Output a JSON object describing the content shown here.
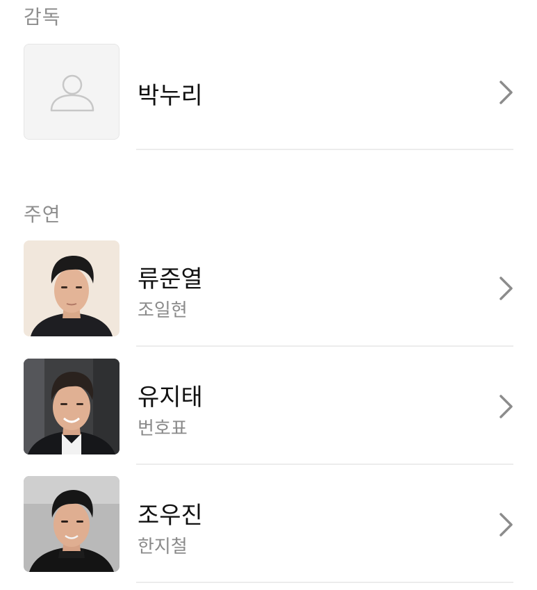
{
  "sections": {
    "director": {
      "label": "감독",
      "people": [
        {
          "name": "박누리",
          "role": "",
          "photo": "person-placeholder-icon"
        }
      ]
    },
    "cast": {
      "label": "주연",
      "people": [
        {
          "name": "류준열",
          "role": "조일현",
          "photo": "actor-photo"
        },
        {
          "name": "유지태",
          "role": "번호표",
          "photo": "actor-photo"
        },
        {
          "name": "조우진",
          "role": "한지철",
          "photo": "actor-photo"
        }
      ]
    }
  },
  "icons": {
    "row_action": "chevron-right-icon",
    "placeholder": "person-placeholder-icon"
  },
  "colors": {
    "section_label": "#8e8e8e",
    "name": "#111111",
    "role": "#8a8a8a",
    "divider": "#ececec",
    "chevron": "#8c8c8c"
  }
}
